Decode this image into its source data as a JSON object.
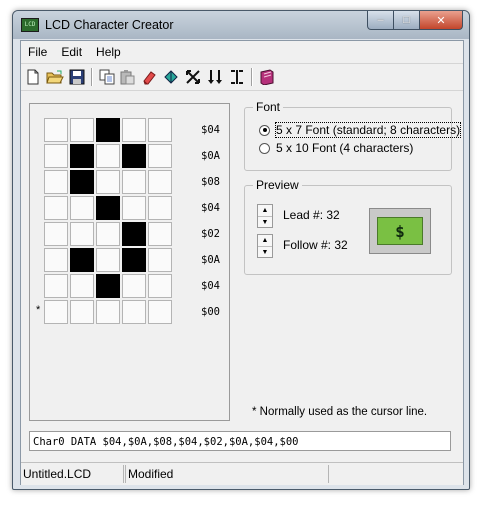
{
  "window": {
    "title": "LCD Character Creator",
    "icon": "lcd-app-icon"
  },
  "caption_buttons": {
    "minimize": "–",
    "maximize": "□",
    "close": "✕"
  },
  "menu": [
    "File",
    "Edit",
    "Help"
  ],
  "toolbar": {
    "buttons": [
      "new-icon",
      "open-icon",
      "save-icon",
      "copy-icon",
      "paste-icon",
      "eraser-icon",
      "fill-icon",
      "shift-icon",
      "flip-vertical-icon",
      "flip-horizontal-icon",
      "book-icon"
    ]
  },
  "editor": {
    "rows": [
      {
        "hex": "$04",
        "bits": [
          0,
          0,
          1,
          0,
          0
        ]
      },
      {
        "hex": "$0A",
        "bits": [
          0,
          1,
          0,
          1,
          0
        ]
      },
      {
        "hex": "$08",
        "bits": [
          0,
          1,
          0,
          0,
          0
        ]
      },
      {
        "hex": "$04",
        "bits": [
          0,
          0,
          1,
          0,
          0
        ]
      },
      {
        "hex": "$02",
        "bits": [
          0,
          0,
          0,
          1,
          0
        ]
      },
      {
        "hex": "$0A",
        "bits": [
          0,
          1,
          0,
          1,
          0
        ]
      },
      {
        "hex": "$04",
        "bits": [
          0,
          0,
          1,
          0,
          0
        ]
      },
      {
        "hex": "$00",
        "bits": [
          0,
          0,
          0,
          0,
          0
        ]
      }
    ],
    "cursor_marker": "*"
  },
  "font_group": {
    "label": "Font",
    "options": [
      {
        "label": "5 x 7 Font (standard; 8 characters)",
        "checked": true
      },
      {
        "label": "5 x 10 Font (4 characters)",
        "checked": false
      }
    ]
  },
  "preview_group": {
    "label": "Preview",
    "lead_label": "Lead #: 32",
    "follow_label": "Follow #: 32",
    "lcd_char": "$"
  },
  "note": "* Normally used as the cursor line.",
  "output": "Char0 DATA $04,$0A,$08,$04,$02,$0A,$04,$00",
  "status": {
    "file": "Untitled.LCD",
    "state": "Modified"
  },
  "colors": {
    "lcd_green": "#7ac043",
    "pixel_on": "#000000",
    "pixel_off": "#fafafa"
  }
}
